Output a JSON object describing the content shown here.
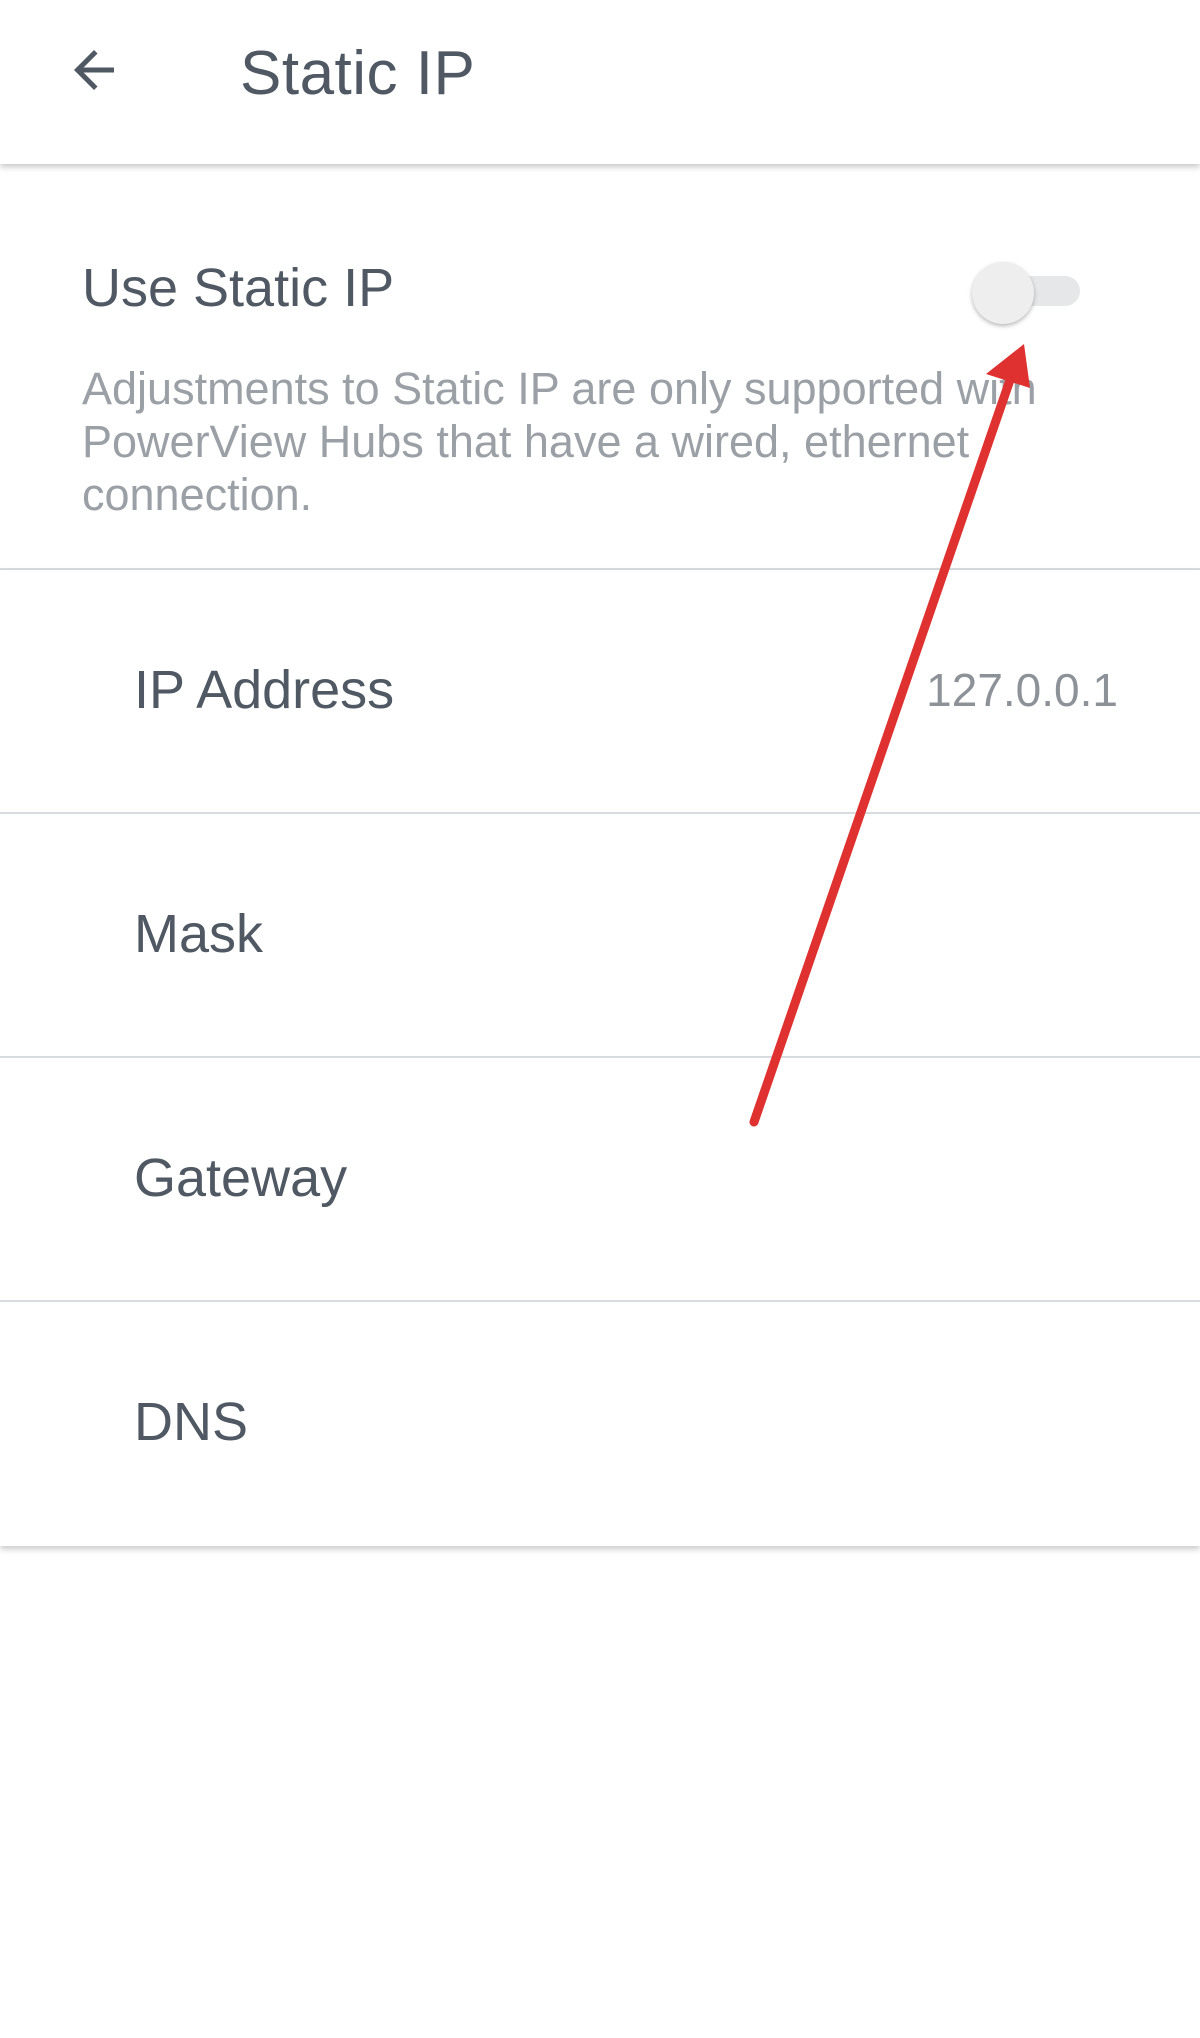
{
  "header": {
    "title": "Static IP",
    "back_icon": "arrow-left-icon"
  },
  "static_ip": {
    "label": "Use Static IP",
    "enabled": false,
    "description": "Adjustments to Static IP are only supported with PowerView Hubs that have a wired, ethernet connection."
  },
  "fields": [
    {
      "label": "IP Address",
      "value": "127.0.0.1"
    },
    {
      "label": "Mask",
      "value": ""
    },
    {
      "label": "Gateway",
      "value": ""
    },
    {
      "label": "DNS",
      "value": ""
    }
  ],
  "colors": {
    "text_primary": "#4f5863",
    "text_secondary": "#9aa0a6",
    "divider": "#d9dcdf",
    "annotation_arrow": "#e03131"
  }
}
